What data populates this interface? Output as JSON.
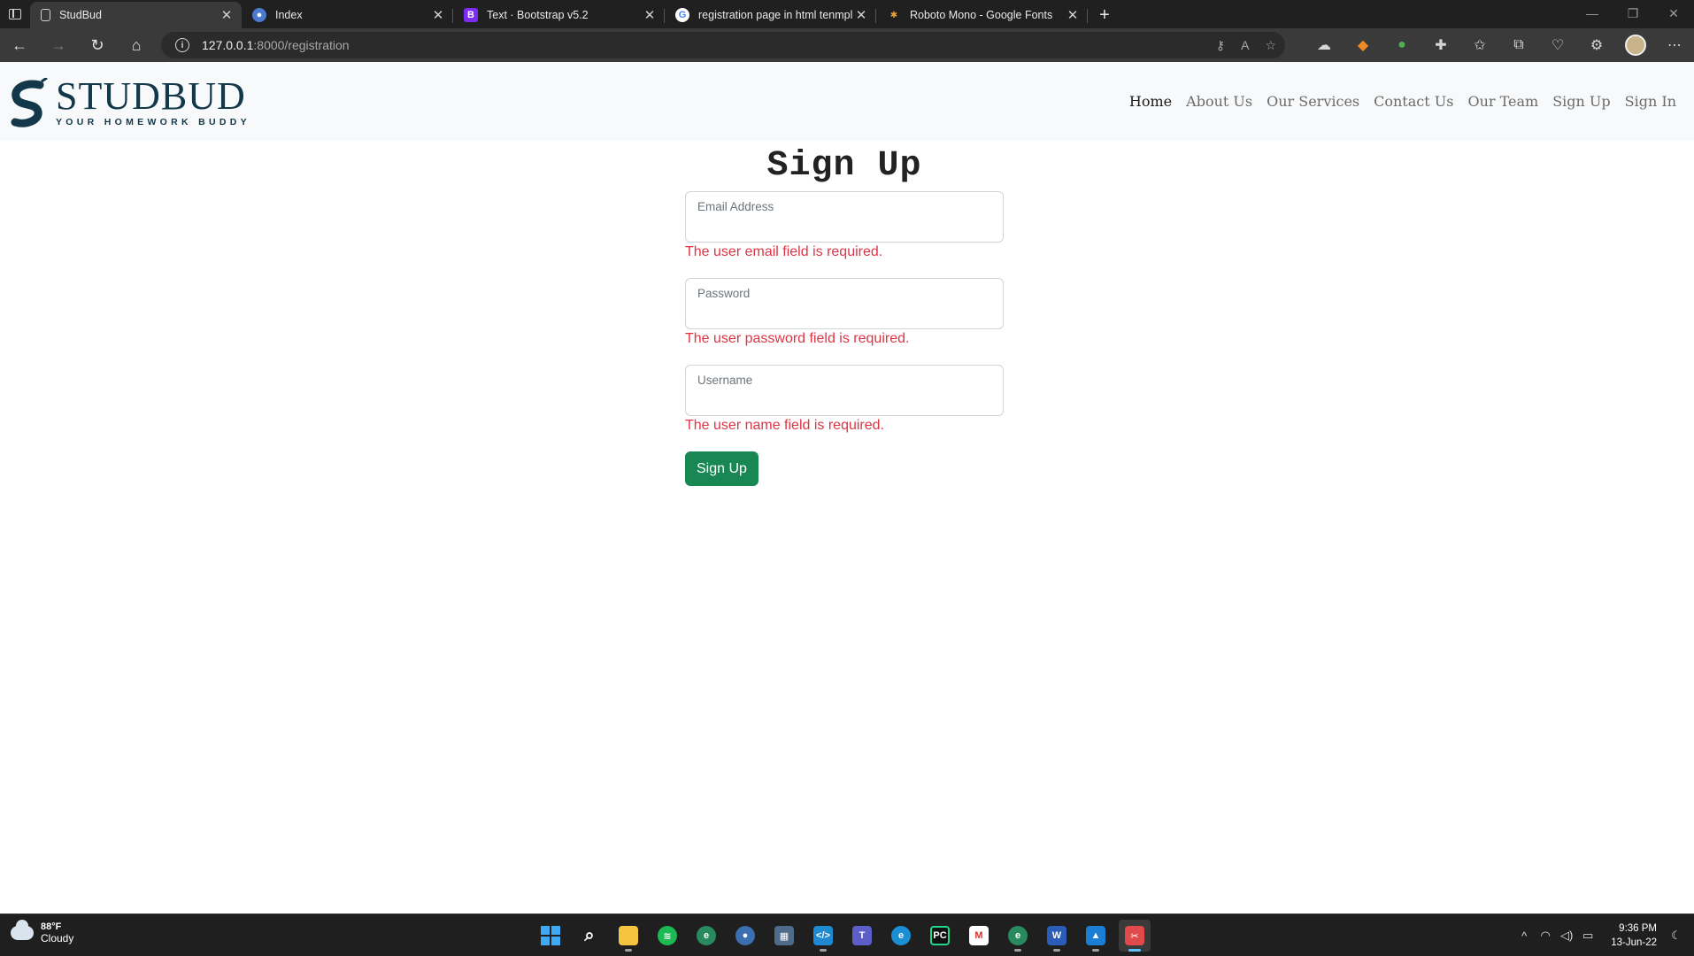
{
  "browser": {
    "tabs": [
      {
        "title": "StudBud",
        "icon": "page-icon",
        "active": true
      },
      {
        "title": "Index",
        "icon": "index-favicon-icon",
        "active": false
      },
      {
        "title": "Text · Bootstrap v5.2",
        "icon": "bootstrap-favicon-icon",
        "active": false
      },
      {
        "title": "registration page in html tenmpl",
        "icon": "google-favicon-icon",
        "active": false
      },
      {
        "title": "Roboto Mono - Google Fonts",
        "icon": "google-fonts-favicon-icon",
        "active": false
      }
    ],
    "address": {
      "host": "127.0.0.1",
      "path": ":8000/registration"
    }
  },
  "site": {
    "logo": {
      "title": "STUDBUD",
      "tagline": "YOUR HOMEWORK BUDDY"
    },
    "nav": [
      "Home",
      "About Us",
      "Our Services",
      "Contact Us",
      "Our Team",
      "Sign Up",
      "Sign In"
    ],
    "active_nav": "Home"
  },
  "form": {
    "title": "Sign Up",
    "fields": [
      {
        "label": "Email Address",
        "value": "",
        "error": "The user email field is required."
      },
      {
        "label": "Password",
        "value": "",
        "error": "The user password field is required."
      },
      {
        "label": "Username",
        "value": "",
        "error": "The user name field is required."
      }
    ],
    "submit_label": "Sign Up"
  },
  "taskbar": {
    "weather": {
      "temp": "88°F",
      "condition": "Cloudy"
    },
    "time": "9:36 PM",
    "date": "13-Jun-22"
  },
  "colors": {
    "error": "#dc3545",
    "submit": "#198754",
    "brand": "#13384a"
  }
}
